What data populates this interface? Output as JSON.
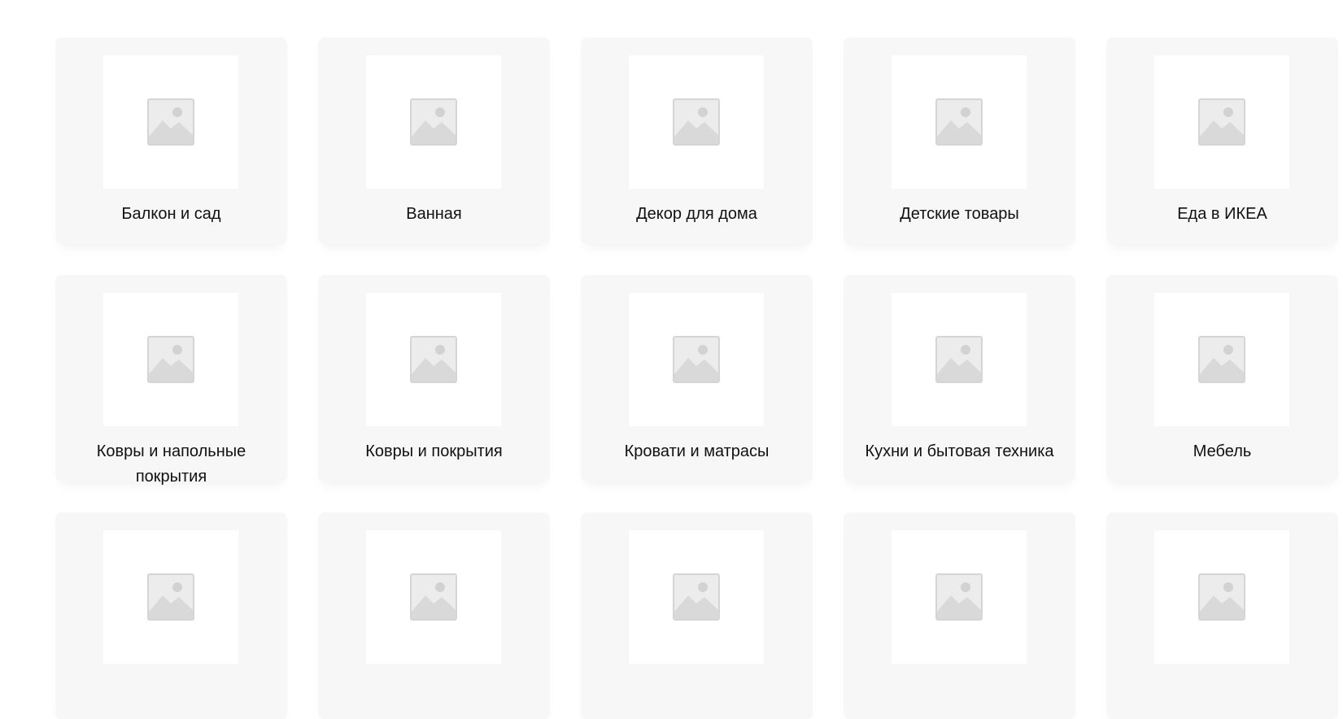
{
  "categories": [
    {
      "label": "Балкон и сад",
      "icon": "image-placeholder-icon"
    },
    {
      "label": "Ванная",
      "icon": "image-placeholder-icon"
    },
    {
      "label": "Декор для дома",
      "icon": "image-placeholder-icon"
    },
    {
      "label": "Детские товары",
      "icon": "image-placeholder-icon"
    },
    {
      "label": "Еда в ИКЕА",
      "icon": "image-placeholder-icon"
    },
    {
      "label": "Ковры и напольные покрытия",
      "icon": "image-placeholder-icon"
    },
    {
      "label": "Ковры и покрытия",
      "icon": "image-placeholder-icon"
    },
    {
      "label": "Кровати и матрасы",
      "icon": "image-placeholder-icon"
    },
    {
      "label": "Кухни и бытовая техника",
      "icon": "image-placeholder-icon"
    },
    {
      "label": "Мебель",
      "icon": "image-placeholder-icon"
    },
    {
      "label": "",
      "icon": "image-placeholder-icon"
    },
    {
      "label": "",
      "icon": "image-placeholder-icon"
    },
    {
      "label": "",
      "icon": "image-placeholder-icon"
    },
    {
      "label": "",
      "icon": "image-placeholder-icon"
    },
    {
      "label": "",
      "icon": "image-placeholder-icon"
    }
  ],
  "colors": {
    "card_background": "#f7f7f7",
    "thumb_background": "#ffffff",
    "placeholder_gray": "#d9d9d9",
    "text": "#111111"
  }
}
